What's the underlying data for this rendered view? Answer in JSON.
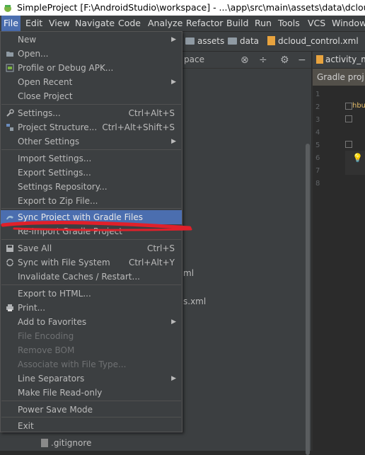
{
  "window": {
    "title": "SimpleProject [F:\\AndroidStudio\\workspace] - ...\\app\\src\\main\\assets\\data\\dcloud_control.xml"
  },
  "menubar": {
    "items": [
      "File",
      "Edit",
      "View",
      "Navigate",
      "Code",
      "Analyze",
      "Refactor",
      "Build",
      "Run",
      "Tools",
      "VCS",
      "Window"
    ],
    "active": "File"
  },
  "breadcrumb": {
    "items": [
      "assets",
      "data",
      "dcloud_control.xml"
    ]
  },
  "project_panel": {
    "header_fragment": "pace",
    "visible_fragments": [
      "ml",
      "s.xml"
    ],
    "tree_item": ".gitignore"
  },
  "editor": {
    "tab": "activity_m",
    "gradle_banner": "Gradle proj",
    "line_numbers": [
      "1",
      "2",
      "3",
      "4",
      "5",
      "6",
      "7",
      "8"
    ],
    "code_fragment": "hbu"
  },
  "file_menu": {
    "items": [
      {
        "label": "New",
        "submenu": true
      },
      {
        "label": "Open...",
        "icon": "folder-open-icon"
      },
      {
        "label": "Profile or Debug APK...",
        "icon": "apk-icon"
      },
      {
        "label": "Open Recent",
        "submenu": true
      },
      {
        "label": "Close Project"
      },
      {
        "label": "Settings...",
        "shortcut": "Ctrl+Alt+S",
        "icon": "wrench-icon"
      },
      {
        "label": "Project Structure...",
        "shortcut": "Ctrl+Alt+Shift+S",
        "icon": "project-structure-icon"
      },
      {
        "label": "Other Settings",
        "submenu": true
      },
      {
        "label": "Import Settings..."
      },
      {
        "label": "Export Settings..."
      },
      {
        "label": "Settings Repository..."
      },
      {
        "label": "Export to Zip File..."
      },
      {
        "label": "Sync Project with Gradle Files",
        "highlighted": true,
        "icon": "gradle-sync-icon"
      },
      {
        "label": "Re-Import Gradle Project"
      },
      {
        "label": "Save All",
        "shortcut": "Ctrl+S",
        "icon": "save-icon"
      },
      {
        "label": "Sync with File System",
        "shortcut": "Ctrl+Alt+Y",
        "icon": "sync-icon"
      },
      {
        "label": "Invalidate Caches / Restart..."
      },
      {
        "label": "Export to HTML..."
      },
      {
        "label": "Print...",
        "icon": "print-icon"
      },
      {
        "label": "Add to Favorites",
        "submenu": true
      },
      {
        "label": "File Encoding",
        "disabled": true
      },
      {
        "label": "Remove BOM",
        "disabled": true
      },
      {
        "label": "Associate with File Type...",
        "disabled": true
      },
      {
        "label": "Line Separators",
        "submenu": true
      },
      {
        "label": "Make File Read-only"
      },
      {
        "label": "Power Save Mode"
      },
      {
        "label": "Exit"
      }
    ]
  },
  "colors": {
    "menu_bg": "#3c3f41",
    "highlight": "#4b6eaf",
    "annotation": "#e0202a"
  }
}
